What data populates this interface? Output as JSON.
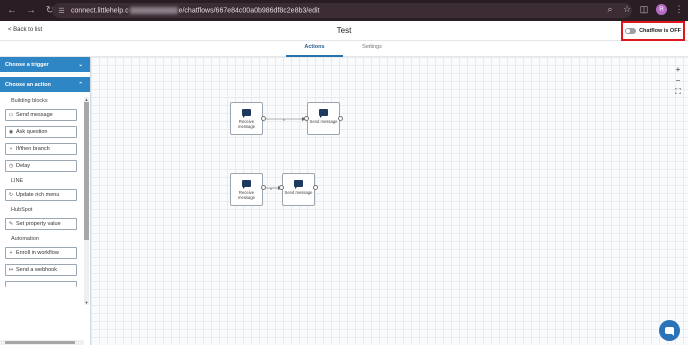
{
  "browser": {
    "url_prefix": "connect.littlehelp.c",
    "url_suffix": "e/chatflows/667e84c00a0b986df8c2e8b3/edit",
    "avatar_letter": "R"
  },
  "header": {
    "back_label": "< Back to list",
    "title": "Test",
    "toggle_label": "Chatflow is OFF"
  },
  "tabs": [
    {
      "label": "Actions"
    },
    {
      "label": "Settings"
    }
  ],
  "sidebar": {
    "trigger_header": "Choose a trigger",
    "action_header": "Choose an action",
    "groups": [
      {
        "label": "Building blocks"
      },
      {
        "label": "LINE"
      },
      {
        "label": "HubSpot"
      },
      {
        "label": "Automation"
      }
    ],
    "items": [
      {
        "label": "Send message",
        "icon": "message-icon"
      },
      {
        "label": "Ask question",
        "icon": "question-icon"
      },
      {
        "label": "If/then branch",
        "icon": "branch-icon"
      },
      {
        "label": "Delay",
        "icon": "clock-icon"
      },
      {
        "label": "Update rich menu",
        "icon": "refresh-icon"
      },
      {
        "label": "Set property value",
        "icon": "pencil-icon"
      },
      {
        "label": "Enroll in workflow",
        "icon": "plus-icon"
      },
      {
        "label": "Send a webhook",
        "icon": "webhook-icon"
      }
    ]
  },
  "canvas": {
    "zoom_in": "+",
    "zoom_out": "−",
    "fit": "⛶",
    "connector_label": "x",
    "flows": [
      {
        "from": "Receive message",
        "to": "Send message"
      },
      {
        "from": "Receive message",
        "to": "Send message"
      }
    ]
  },
  "colors": {
    "accent": "#2f86c4",
    "toggle_highlight": "#e0161e",
    "node_icon": "#1f3a5f"
  }
}
